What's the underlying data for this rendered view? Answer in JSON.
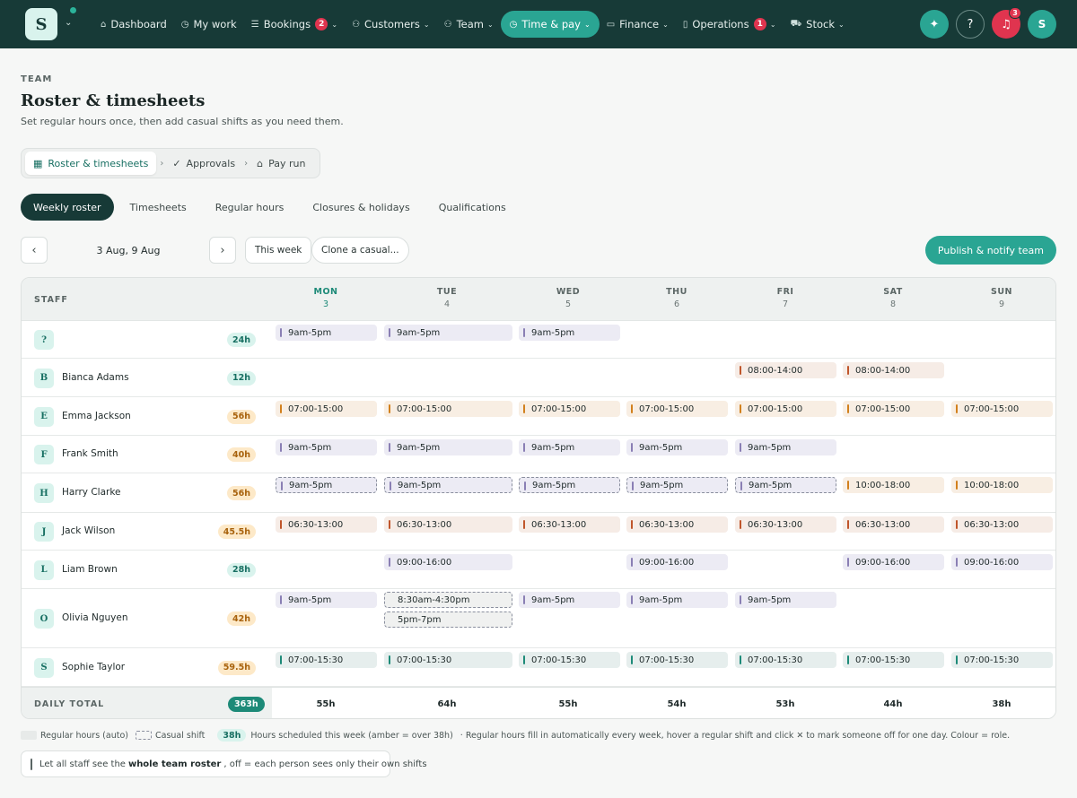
{
  "nav": {
    "logo_letter": "S",
    "items": [
      {
        "label": "Dashboard",
        "icon": "home-icon",
        "glyph": "⌂",
        "caret": false
      },
      {
        "label": "My work",
        "icon": "clock-icon",
        "glyph": "◷",
        "caret": false
      },
      {
        "label": "Bookings",
        "icon": "list-icon",
        "glyph": "☰",
        "badge": "2",
        "caret": true
      },
      {
        "label": "Customers",
        "icon": "customers-icon",
        "glyph": "⚇",
        "caret": true
      },
      {
        "label": "Team",
        "icon": "team-icon",
        "glyph": "⚇",
        "caret": true
      },
      {
        "label": "Time & pay",
        "icon": "clock-icon",
        "glyph": "◷",
        "caret": true,
        "active": true
      },
      {
        "label": "Finance",
        "icon": "card-icon",
        "glyph": "▭",
        "caret": true
      },
      {
        "label": "Operations",
        "icon": "clipboard-icon",
        "glyph": "▯",
        "badge": "1",
        "caret": true
      },
      {
        "label": "Stock",
        "icon": "cart-icon",
        "glyph": "⛟",
        "caret": true
      }
    ],
    "notification_count": "3",
    "avatar_letter": "S"
  },
  "header": {
    "eyebrow": "TEAM",
    "title": "Roster & timesheets",
    "subtitle": "Set regular hours once, then add casual shifts as you need them."
  },
  "crumbs": [
    {
      "label": "Roster & timesheets",
      "icon": "calendar-icon",
      "glyph": "▦",
      "active": true
    },
    {
      "label": "Approvals",
      "icon": "check-circle-icon",
      "glyph": "✓"
    },
    {
      "label": "Pay run",
      "icon": "bank-icon",
      "glyph": "⌂"
    }
  ],
  "tabs": [
    "Weekly roster",
    "Timesheets",
    "Regular hours",
    "Closures & holidays",
    "Qualifications"
  ],
  "toolbar": {
    "date_range": "3 Aug, 9 Aug",
    "this_week": "This week",
    "clone": "Clone a casual...",
    "publish": "Publish & notify team"
  },
  "roster": {
    "staff_header": "STAFF",
    "days": [
      {
        "name": "MON",
        "num": "3",
        "today": true
      },
      {
        "name": "TUE",
        "num": "4"
      },
      {
        "name": "WED",
        "num": "5"
      },
      {
        "name": "THU",
        "num": "6"
      },
      {
        "name": "FRI",
        "num": "7"
      },
      {
        "name": "SAT",
        "num": "8"
      },
      {
        "name": "SUN",
        "num": "9"
      }
    ],
    "role_colors": {
      "purple": "#8a7fb4",
      "orange": "#d2801d",
      "red": "#c0562b",
      "teal": "#1d8a78"
    },
    "shift_bg": {
      "purple": "#ecebf4",
      "orange": "#f8eee3",
      "red": "#f6ece6",
      "teal": "#e6eeed"
    },
    "staff": [
      {
        "initial": "?",
        "name": "",
        "hours": "24h",
        "over": false,
        "shifts": [
          [
            0,
            "9am-5pm",
            "purple"
          ],
          [
            1,
            "9am-5pm",
            "purple"
          ],
          [
            2,
            "9am-5pm",
            "purple"
          ]
        ]
      },
      {
        "initial": "B",
        "name": "Bianca Adams",
        "hours": "12h",
        "over": false,
        "shifts": [
          [
            4,
            "08:00-14:00",
            "red"
          ],
          [
            5,
            "08:00-14:00",
            "red"
          ]
        ]
      },
      {
        "initial": "E",
        "name": "Emma Jackson",
        "hours": "56h",
        "over": true,
        "shifts": [
          [
            0,
            "07:00-15:00",
            "orange"
          ],
          [
            1,
            "07:00-15:00",
            "orange"
          ],
          [
            2,
            "07:00-15:00",
            "orange"
          ],
          [
            3,
            "07:00-15:00",
            "orange"
          ],
          [
            4,
            "07:00-15:00",
            "orange"
          ],
          [
            5,
            "07:00-15:00",
            "orange"
          ],
          [
            6,
            "07:00-15:00",
            "orange"
          ]
        ]
      },
      {
        "initial": "F",
        "name": "Frank Smith",
        "hours": "40h",
        "over": true,
        "shifts": [
          [
            0,
            "9am-5pm",
            "purple"
          ],
          [
            1,
            "9am-5pm",
            "purple"
          ],
          [
            2,
            "9am-5pm",
            "purple"
          ],
          [
            3,
            "9am-5pm",
            "purple"
          ],
          [
            4,
            "9am-5pm",
            "purple"
          ]
        ]
      },
      {
        "initial": "H",
        "name": "Harry Clarke",
        "hours": "56h",
        "over": true,
        "shifts": [
          [
            0,
            "9am-5pm",
            "purple",
            true
          ],
          [
            1,
            "9am-5pm",
            "purple",
            true
          ],
          [
            2,
            "9am-5pm",
            "purple",
            true
          ],
          [
            3,
            "9am-5pm",
            "purple",
            true
          ],
          [
            4,
            "9am-5pm",
            "purple",
            true
          ],
          [
            5,
            "10:00-18:00",
            "orange"
          ],
          [
            6,
            "10:00-18:00",
            "orange"
          ]
        ]
      },
      {
        "initial": "J",
        "name": "Jack Wilson",
        "hours": "45.5h",
        "over": true,
        "shifts": [
          [
            0,
            "06:30-13:00",
            "red"
          ],
          [
            1,
            "06:30-13:00",
            "red"
          ],
          [
            2,
            "06:30-13:00",
            "red"
          ],
          [
            3,
            "06:30-13:00",
            "red"
          ],
          [
            4,
            "06:30-13:00",
            "red"
          ],
          [
            5,
            "06:30-13:00",
            "red"
          ],
          [
            6,
            "06:30-13:00",
            "red"
          ]
        ]
      },
      {
        "initial": "L",
        "name": "Liam Brown",
        "hours": "28h",
        "over": false,
        "shifts": [
          [
            1,
            "09:00-16:00",
            "purple"
          ],
          [
            3,
            "09:00-16:00",
            "purple"
          ],
          [
            5,
            "09:00-16:00",
            "purple"
          ],
          [
            6,
            "09:00-16:00",
            "purple"
          ]
        ]
      },
      {
        "initial": "O",
        "name": "Olivia Nguyen",
        "hours": "42h",
        "over": true,
        "shifts": [
          [
            0,
            "9am-5pm",
            "purple"
          ],
          [
            1,
            "8:30am-4:30pm",
            "none",
            true
          ],
          [
            1,
            "5pm-7pm",
            "none",
            true,
            1
          ],
          [
            2,
            "9am-5pm",
            "purple"
          ],
          [
            3,
            "9am-5pm",
            "purple"
          ],
          [
            4,
            "9am-5pm",
            "purple"
          ]
        ]
      },
      {
        "initial": "S",
        "name": "Sophie Taylor",
        "hours": "59.5h",
        "over": true,
        "shifts": [
          [
            0,
            "07:00-15:30",
            "teal"
          ],
          [
            1,
            "07:00-15:30",
            "teal"
          ],
          [
            2,
            "07:00-15:30",
            "teal"
          ],
          [
            3,
            "07:00-15:30",
            "teal"
          ],
          [
            4,
            "07:00-15:30",
            "teal"
          ],
          [
            5,
            "07:00-15:30",
            "teal"
          ],
          [
            6,
            "07:00-15:30",
            "teal"
          ]
        ]
      }
    ],
    "totals": {
      "label": "DAILY TOTAL",
      "grand": "363h",
      "days": [
        "55h",
        "64h",
        "55h",
        "54h",
        "53h",
        "44h",
        "38h"
      ]
    }
  },
  "legend": {
    "regular": "Regular hours (auto)",
    "casual": "Casual shift",
    "hours_badge": "38h",
    "hours_text": "Hours scheduled this week (amber = over 38h)",
    "note": "· Regular hours fill in automatically every week, hover a regular shift and click ✕ to mark someone off for one day. Colour = role."
  },
  "visibility": {
    "prefix": "Let all staff see the",
    "bold": "whole team roster",
    "suffix": ", off = each person sees only their own shifts"
  }
}
